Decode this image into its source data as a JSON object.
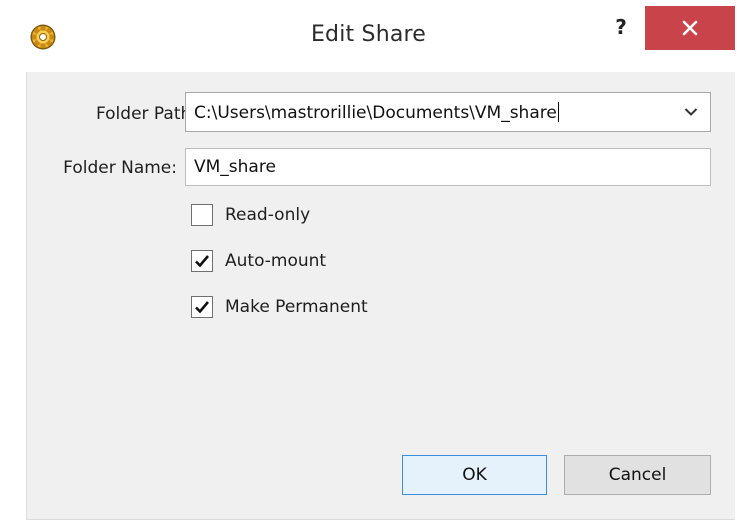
{
  "window": {
    "title": "Edit Share",
    "help_label": "?",
    "icons": {
      "app": "gear-icon",
      "close": "close-icon"
    },
    "colors": {
      "close_button": "#c9434a",
      "ok_border": "#3c8fdc"
    }
  },
  "form": {
    "folder_path_label": "Folder Path:",
    "folder_path_value": "C:\\Users\\mastrorillie\\Documents\\VM_share",
    "folder_name_label": "Folder Name:",
    "folder_name_value": "VM_share",
    "options": [
      {
        "label": "Read-only",
        "checked": false
      },
      {
        "label": "Auto-mount",
        "checked": true
      },
      {
        "label": "Make Permanent",
        "checked": true
      }
    ]
  },
  "buttons": {
    "ok_label": "OK",
    "cancel_label": "Cancel"
  }
}
